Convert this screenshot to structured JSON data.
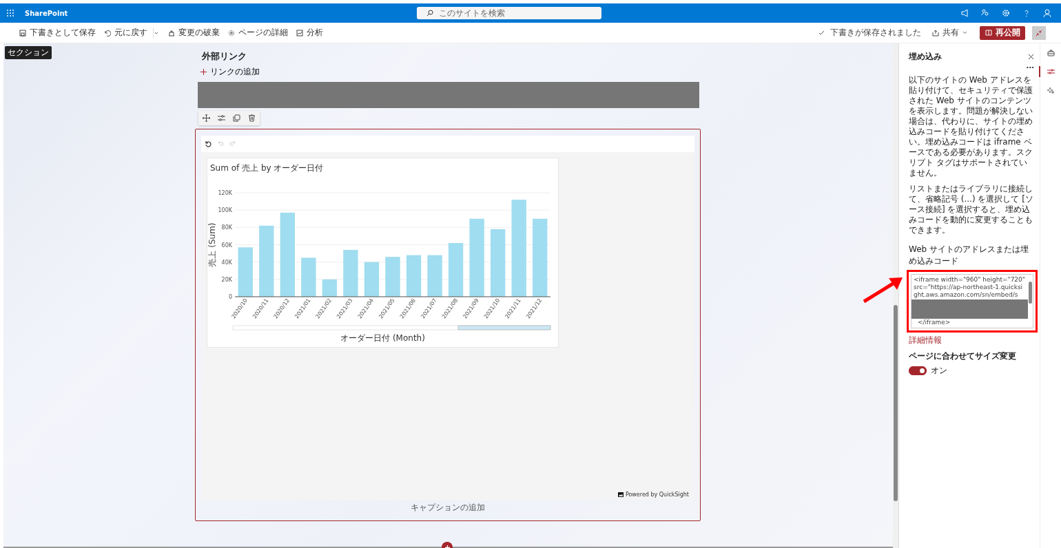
{
  "app": {
    "name": "SharePoint"
  },
  "search": {
    "placeholder": "このサイトを検索"
  },
  "command_bar": {
    "items": [
      {
        "kind": "save",
        "label": "下書きとして保存"
      },
      {
        "kind": "undo",
        "label": "元に戻す"
      },
      {
        "kind": "discard",
        "label": "変更の破棄"
      },
      {
        "kind": "details",
        "label": "ページの詳細"
      },
      {
        "kind": "analytics",
        "label": "分析"
      }
    ],
    "status": "下書きが保存されました",
    "share": "共有",
    "republish": "再公開"
  },
  "section_tag": "セクション",
  "links_webpart": {
    "title": "外部リンク",
    "add_link": "リンクの追加"
  },
  "embed_webpart": {
    "chart_data": {
      "type": "bar",
      "title": "Sum of 売上 by オーダー日付",
      "xlabel": "オーダー日付 (Month)",
      "ylabel": "売上 (Sum)",
      "categories": [
        "2020/10",
        "2020/11",
        "2020/12",
        "2021/01",
        "2021/02",
        "2021/03",
        "2021/04",
        "2021/05",
        "2021/06",
        "2021/07",
        "2021/08",
        "2021/09",
        "2021/10",
        "2021/11",
        "2021/12"
      ],
      "values": [
        57000,
        82000,
        97000,
        45000,
        20000,
        54000,
        40000,
        46000,
        48000,
        48000,
        62000,
        90000,
        78000,
        112000,
        90000
      ],
      "grid": true,
      "ylim": [
        0,
        120000
      ],
      "yticks": [
        {
          "value": 0,
          "label": "0"
        },
        {
          "value": 20000,
          "label": "20K"
        },
        {
          "value": 40000,
          "label": "40K"
        },
        {
          "value": 60000,
          "label": "60K"
        },
        {
          "value": 80000,
          "label": "80K"
        },
        {
          "value": 100000,
          "label": "100K"
        },
        {
          "value": 120000,
          "label": "120K"
        }
      ]
    },
    "powered_by": "Powered by QuickSight",
    "caption_placeholder": "キャプションの追加"
  },
  "panel": {
    "title": "埋め込み",
    "more": "...",
    "paragraphs": [
      "以下のサイトの Web アドレスを貼り付けて、セキュリティで保護された Web サイトのコンテンツを表示します。問題が解決しない場合は、代わりに、サイトの埋め込みコードを貼り付けてください。埋め込みコードは iframe ベースである必要があります。スクリプト タグはサポートされていません。",
      "リストまたはライブラリに接続して、省略記号 (...) を選択して [ソース接続] を選択すると、埋め込みコードを動的に変更することもできます。"
    ],
    "field_label": "Web サイトのアドレスまたは埋め込みコード",
    "embed_code": "<iframe width=\"960\" height=\"720\" src=\"https://ap-northeast-1.quicksight.aws.amazon.com/sn/embed/s",
    "embed_code_end": "</iframe>",
    "learn_more": "詳細情報",
    "resize_label": "ページに合わせてサイズ変更",
    "resize_toggle": {
      "on": true,
      "label": "オン"
    }
  }
}
